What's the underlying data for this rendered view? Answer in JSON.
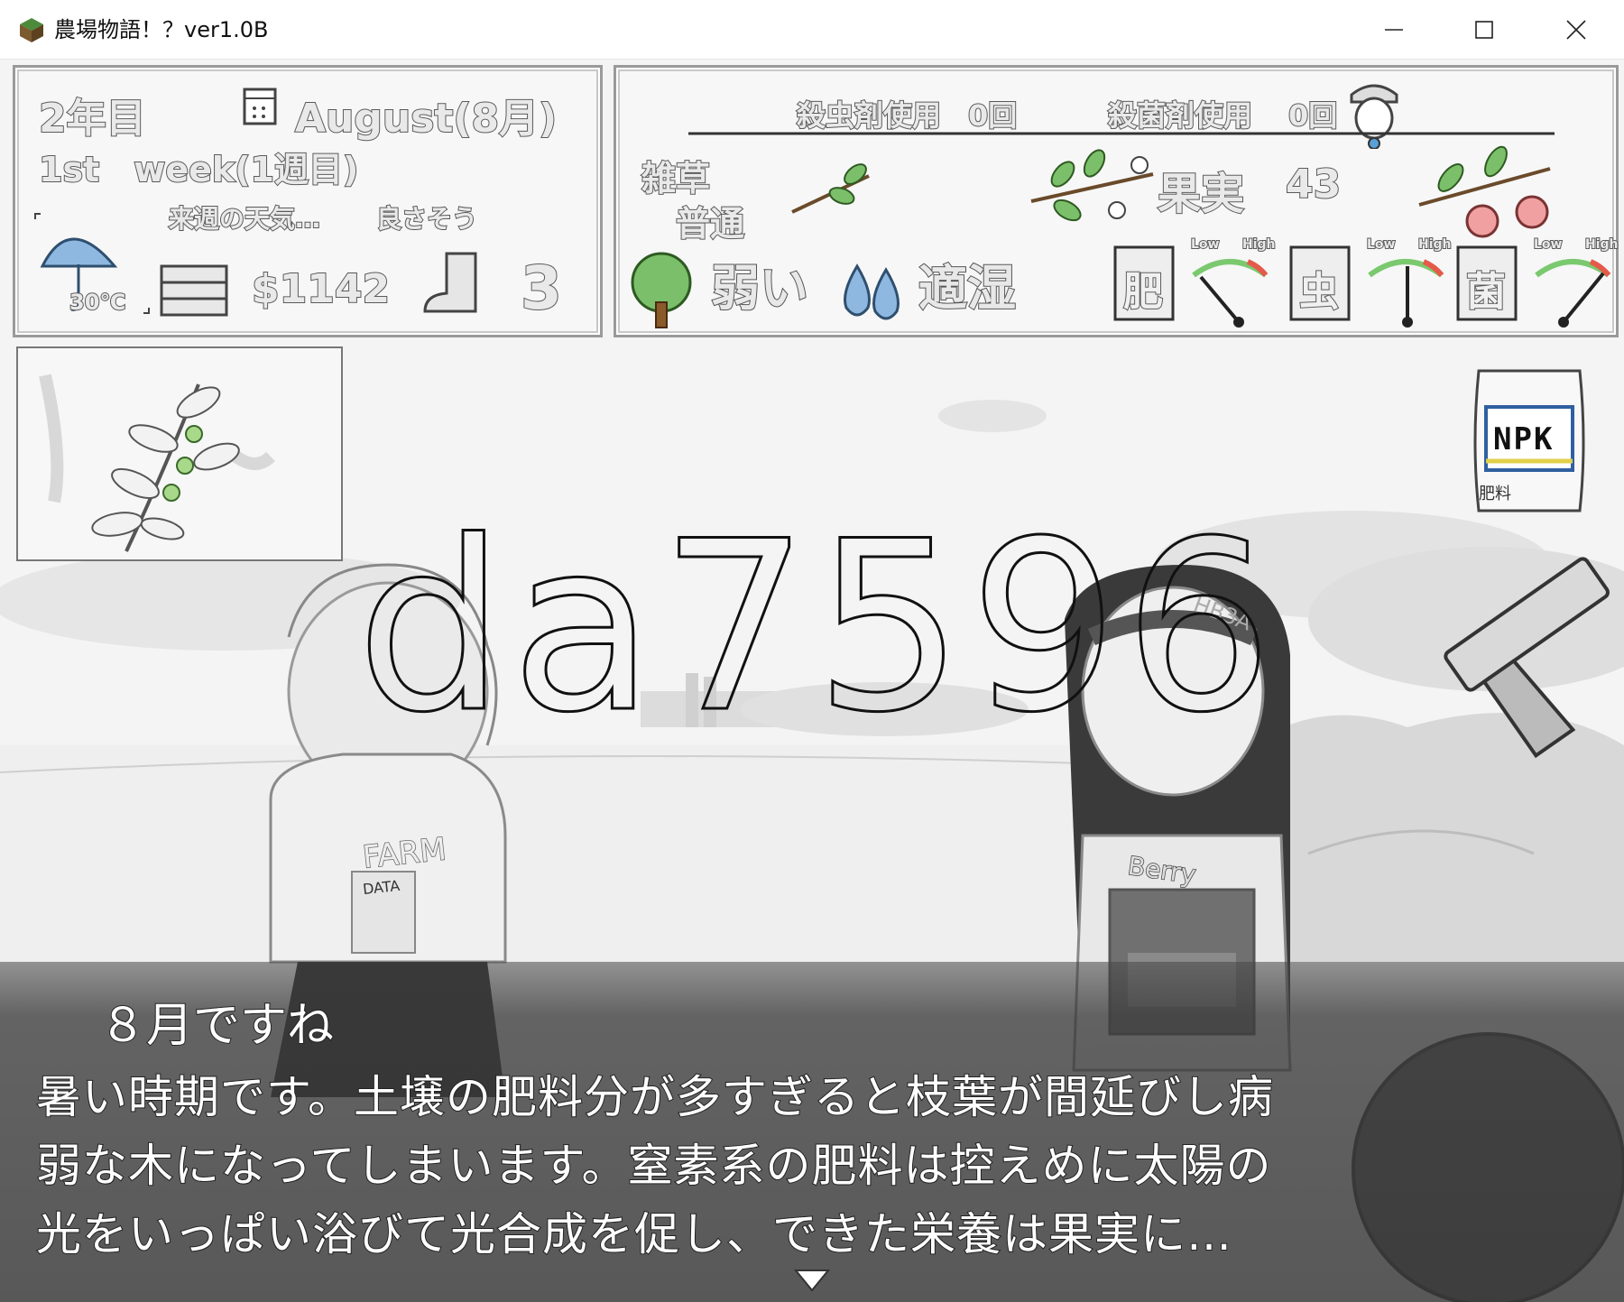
{
  "window": {
    "title": "農場物語！？ver1.0B",
    "controls": [
      "minimize",
      "maximize",
      "close"
    ]
  },
  "status": {
    "year": "2年目",
    "month": "August(8月)",
    "week": "1st　week(1週目)",
    "forecast_label": "来週の天気…",
    "forecast_value": "良さそう",
    "temperature": "30℃",
    "money": "$1142",
    "stamina": "3"
  },
  "farm": {
    "insecticide_label": "殺虫剤使用",
    "insecticide_count": "0回",
    "fungicide_label": "殺菌剤使用",
    "fungicide_count": "0回",
    "weeds_label": "雑草",
    "weeds_value": "普通",
    "fruit_label": "果実",
    "fruit_count": "43",
    "tree_strength": "弱い",
    "moisture": "適湿",
    "gauges": [
      {
        "label": "肥",
        "low": "Low",
        "high": "High",
        "level": 0.15
      },
      {
        "label": "虫",
        "low": "Low",
        "high": "High",
        "level": 0.5
      },
      {
        "label": "菌",
        "low": "Low",
        "high": "High",
        "level": 0.85
      }
    ]
  },
  "items": {
    "fertilizer_bag_label": "NPK",
    "fertilizer_bag_sub": "肥料",
    "character_names": [
      "FARM",
      "DATA",
      "Berry",
      "HB3A"
    ]
  },
  "watermark": "da7596",
  "dialogue": {
    "speaker_line": "８月ですね",
    "lines": [
      "暑い時期です。土壌の肥料分が多すぎると枝葉が間延びし病",
      "弱な木になってしまいます。窒素系の肥料は控えめに太陽の",
      "光をいっぱい浴びて光合成を促し、できた栄養は果実に…"
    ]
  },
  "colors": {
    "hud_panel": "#f6f6f6",
    "hud_border": "#9a9a9a",
    "message_bg": "#3c3c3c",
    "umbrella": "#8fb8e0",
    "drop": "#8fb8e0",
    "leaf": "#7bbf6a",
    "cherry": "#f0a0a0",
    "gauge_good": "#7bc96f",
    "gauge_bad": "#e55a4a"
  }
}
